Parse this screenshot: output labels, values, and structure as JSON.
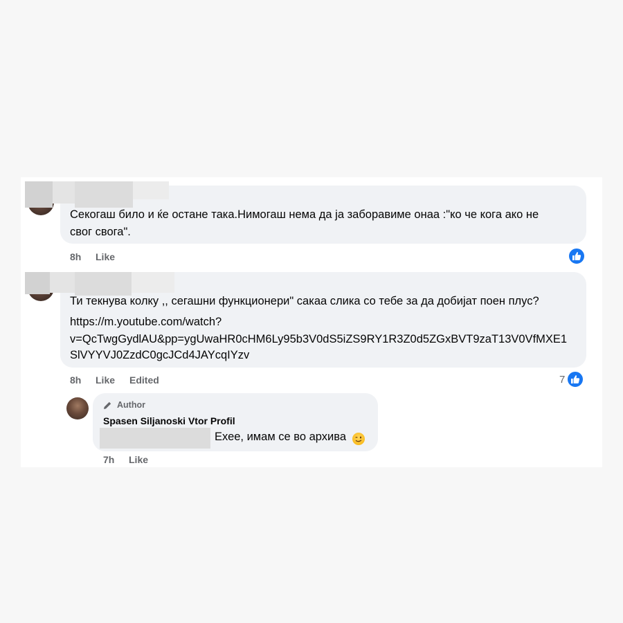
{
  "comments": [
    {
      "text_line1": "Секогаш било и ќе остане така.Нимогаш нема да ја заборавиме онаа :\"ко че кога ако не",
      "text_line2": "свог свога\".",
      "time": "8h",
      "like_label": "Like"
    },
    {
      "text_line1": "Ти текнува колку ,, сегашни функционери\" сакаа слика со тебе за да добијат поен плус?",
      "link_line1": "https://m.youtube.com/watch?",
      "link_line2": "v=QcTwgGydlAU&pp=ygUwaHR0cHM6Ly95b3V0dS5iZS9RY1R3Z0d5ZGxBVT9zaT13V0VfMXE1",
      "link_line3": "SlVYYVJ0ZzdC0gcJCd4JAYcqIYzv",
      "time": "8h",
      "like_label": "Like",
      "edited_label": "Edited",
      "reaction_count": "7"
    }
  ],
  "reply": {
    "author_badge": "Author",
    "author_name": "Spasen Siljanoski Vtor Profil",
    "text": "Ехее, имам се во архива",
    "emoji": "wink-emoji",
    "time": "7h",
    "like_label": "Like"
  },
  "colors": {
    "bubble": "#f0f2f5",
    "like_blue": "#1877f2",
    "meta_gray": "#65676b"
  }
}
